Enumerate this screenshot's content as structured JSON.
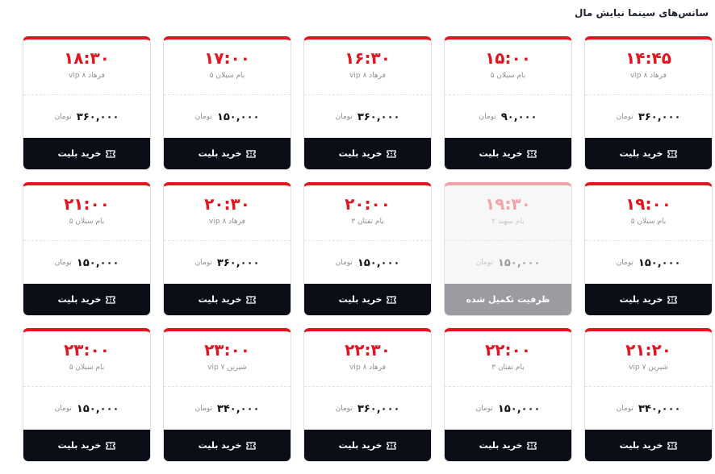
{
  "page_title": "سانس‌های سینما نیایش مال",
  "currency": "تومان",
  "buy_label": "خرید بلیت",
  "full_label": "ظرفیت تکمیل شده",
  "colors": {
    "accent": "#e4141e",
    "button": "#0b0d17",
    "disabled": "#9a9ca1"
  },
  "sessions": [
    {
      "time": "۱۴:۴۵",
      "hall": "فرهاد ۸ vip",
      "price": "۳۶۰,۰۰۰",
      "full": false
    },
    {
      "time": "۱۵:۰۰",
      "hall": "بام سیلان ۵",
      "price": "۹۰,۰۰۰",
      "full": false
    },
    {
      "time": "۱۶:۳۰",
      "hall": "فرهاد ۸ vip",
      "price": "۳۶۰,۰۰۰",
      "full": false
    },
    {
      "time": "۱۷:۰۰",
      "hall": "بام سیلان ۵",
      "price": "۱۵۰,۰۰۰",
      "full": false
    },
    {
      "time": "۱۸:۳۰",
      "hall": "فرهاد ۸ vip",
      "price": "۳۶۰,۰۰۰",
      "full": false
    },
    {
      "time": "۱۹:۰۰",
      "hall": "بام سیلان ۵",
      "price": "۱۵۰,۰۰۰",
      "full": false
    },
    {
      "time": "۱۹:۳۰",
      "hall": "بام سهند ۲",
      "price": "۱۵۰,۰۰۰",
      "full": true
    },
    {
      "time": "۲۰:۰۰",
      "hall": "بام تفتان ۳",
      "price": "۱۵۰,۰۰۰",
      "full": false
    },
    {
      "time": "۲۰:۳۰",
      "hall": "فرهاد ۸ vip",
      "price": "۳۶۰,۰۰۰",
      "full": false
    },
    {
      "time": "۲۱:۰۰",
      "hall": "بام سیلان ۵",
      "price": "۱۵۰,۰۰۰",
      "full": false
    },
    {
      "time": "۲۱:۲۰",
      "hall": "شیرین ۷ vip",
      "price": "۳۴۰,۰۰۰",
      "full": false
    },
    {
      "time": "۲۲:۰۰",
      "hall": "بام تفتان ۳",
      "price": "۱۵۰,۰۰۰",
      "full": false
    },
    {
      "time": "۲۲:۳۰",
      "hall": "فرهاد ۸ vip",
      "price": "۳۶۰,۰۰۰",
      "full": false
    },
    {
      "time": "۲۳:۰۰",
      "hall": "شیرین ۷ vip",
      "price": "۳۴۰,۰۰۰",
      "full": false
    },
    {
      "time": "۲۳:۰۰",
      "hall": "بام سیلان ۵",
      "price": "۱۵۰,۰۰۰",
      "full": false
    }
  ]
}
